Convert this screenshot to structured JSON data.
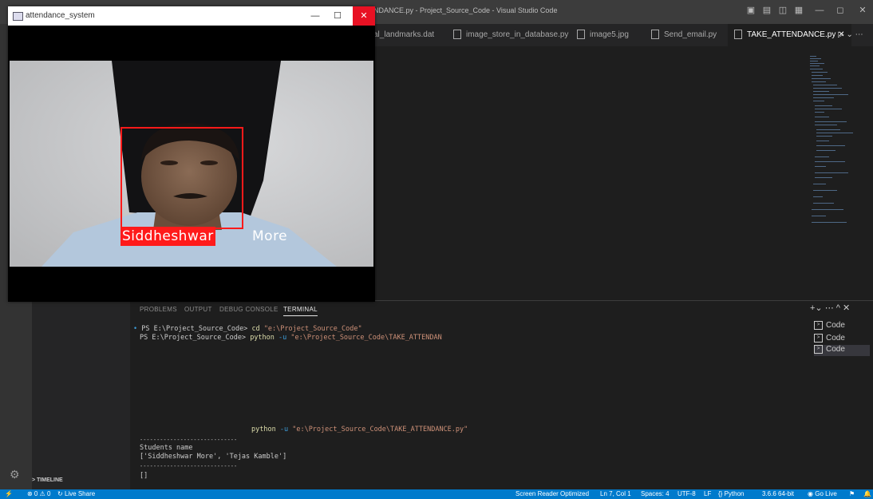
{
  "vscode": {
    "title": "NDANCE.py - Project_Source_Code - Visual Studio Code",
    "tabs": [
      {
        "label": "al_landmarks.dat",
        "active": false
      },
      {
        "label": "image_store_in_database.py",
        "active": false
      },
      {
        "label": "image5.jpg",
        "active": false
      },
      {
        "label": "Send_email.py",
        "active": false
      },
      {
        "label": "TAKE_ATTENDANCE.py",
        "active": true
      }
    ],
    "panel_tabs": [
      "PROBLEMS",
      "OUTPUT",
      "DEBUG CONSOLE",
      "TERMINAL"
    ],
    "active_panel_tab": "TERMINAL",
    "terminal": {
      "line1_prompt": "PS E:\\Project_Source_Code>",
      "line1_cmd": "cd",
      "line1_arg": "\"e:\\Project_Source_Code\"",
      "line2_prompt": "PS E:\\Project_Source_Code>",
      "line2_cmd": "python",
      "line2_flag": "-u",
      "line2_arg": "\"e:\\Project_Source_Code\\TAKE_ATTENDAN",
      "line3_cmd": "python",
      "line3_flag": "-u",
      "line3_arg": "\"e:\\Project_Source_Code\\TAKE_ATTENDANCE.py\"",
      "separator": "-----------------------------",
      "students_label": "Students name",
      "students_list": "['Siddheshwar More', 'Tejas Kamble']",
      "cursor": "[]"
    },
    "terminal_list": [
      "Code",
      "Code",
      "Code"
    ],
    "timeline_label": "> TIMELINE",
    "status": {
      "errors": "⊗ 0 ⚠ 0",
      "live_share": "Live Share",
      "screen_reader": "Screen Reader Optimized",
      "position": "Ln 7, Col 1",
      "spaces": "Spaces: 4",
      "encoding": "UTF-8",
      "eol": "LF",
      "language": "Python",
      "interpreter": "3.6.6 64-bit",
      "go_live": "Go Live"
    }
  },
  "camera_window": {
    "title": "attendance_system",
    "recognized_name_part1": "Siddheshwar",
    "recognized_name_part2": "More"
  },
  "colors": {
    "statusbar": "#007acc",
    "face_box": "#ff1a1a",
    "close_button": "#e81123"
  }
}
